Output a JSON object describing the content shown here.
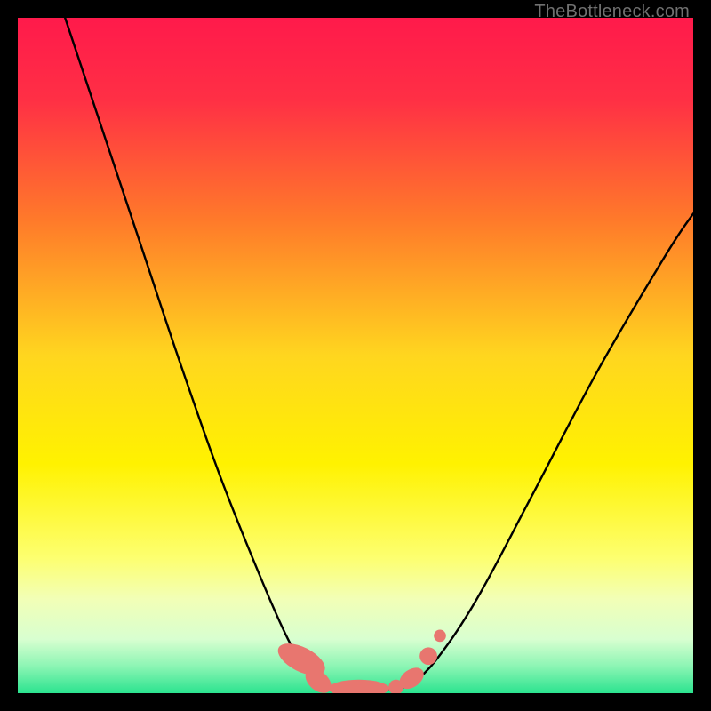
{
  "watermark": "TheBottleneck.com",
  "chart_data": {
    "type": "line",
    "title": "",
    "xlabel": "",
    "ylabel": "",
    "xlim": [
      0,
      100
    ],
    "ylim": [
      0,
      100
    ],
    "gradient_stops": [
      {
        "offset": 0.0,
        "color": "#ff1a4b"
      },
      {
        "offset": 0.12,
        "color": "#ff2f45"
      },
      {
        "offset": 0.3,
        "color": "#ff7a2a"
      },
      {
        "offset": 0.5,
        "color": "#ffd61f"
      },
      {
        "offset": 0.66,
        "color": "#fff200"
      },
      {
        "offset": 0.8,
        "color": "#fdff70"
      },
      {
        "offset": 0.86,
        "color": "#f2ffb6"
      },
      {
        "offset": 0.92,
        "color": "#d8ffd0"
      },
      {
        "offset": 0.96,
        "color": "#8cf5b4"
      },
      {
        "offset": 1.0,
        "color": "#2be38f"
      }
    ],
    "series": [
      {
        "name": "left-branch",
        "color": "#000000",
        "x": [
          7,
          12,
          18,
          24,
          30,
          36,
          40,
          43,
          45
        ],
        "y": [
          100,
          85,
          67,
          49,
          32,
          17,
          8,
          3,
          1
        ]
      },
      {
        "name": "valley-floor",
        "color": "#000000",
        "x": [
          45,
          48,
          52,
          56,
          58
        ],
        "y": [
          1,
          0.5,
          0.5,
          0.7,
          1
        ]
      },
      {
        "name": "right-branch",
        "color": "#000000",
        "x": [
          58,
          62,
          68,
          76,
          86,
          96,
          100
        ],
        "y": [
          1,
          5,
          14,
          29,
          48,
          65,
          71
        ]
      }
    ],
    "markers": [
      {
        "shape": "pill",
        "cx": 42.0,
        "cy": 5.0,
        "rx": 1.8,
        "ry": 3.8,
        "angle": -63,
        "color": "#e8766f"
      },
      {
        "shape": "pill",
        "cx": 44.5,
        "cy": 1.8,
        "rx": 1.4,
        "ry": 2.2,
        "angle": -50,
        "color": "#e8766f"
      },
      {
        "shape": "pill",
        "cx": 50.5,
        "cy": 0.7,
        "rx": 4.5,
        "ry": 1.3,
        "angle": 0,
        "color": "#e8766f"
      },
      {
        "shape": "dot",
        "cx": 56.0,
        "cy": 0.9,
        "r": 1.1,
        "color": "#e8766f"
      },
      {
        "shape": "pill",
        "cx": 58.3,
        "cy": 2.2,
        "rx": 1.3,
        "ry": 2.0,
        "angle": 55,
        "color": "#e8766f"
      },
      {
        "shape": "dot",
        "cx": 60.8,
        "cy": 5.5,
        "r": 1.3,
        "color": "#e8766f"
      },
      {
        "shape": "dot",
        "cx": 62.5,
        "cy": 8.5,
        "r": 0.9,
        "color": "#e8766f"
      }
    ]
  }
}
